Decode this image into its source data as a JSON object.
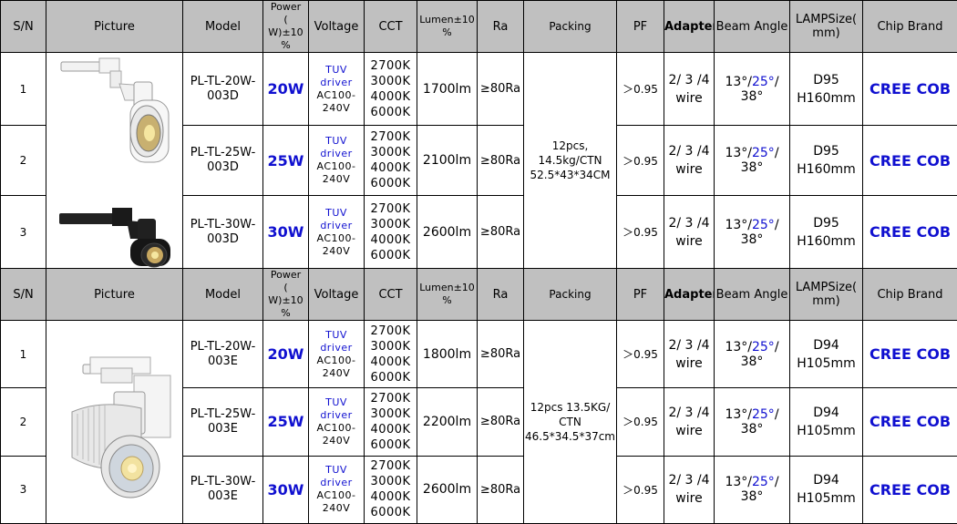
{
  "headers": {
    "sn": "S/N",
    "picture": "Picture",
    "model": "Model",
    "power_l1": "Power",
    "power_l2": "(",
    "power_l3": "W)±10",
    "power_l4": "%",
    "voltage": "Voltage",
    "cct": "CCT",
    "lumen_l1": "Lumen±10",
    "lumen_l2": "%",
    "ra": "Ra",
    "packing": "Packing",
    "pf": "PF",
    "adapter": "Adapter",
    "beam": "Beam Angle",
    "size_l1": "LAMPSize(",
    "size_l2": "mm)",
    "chip": "Chip Brand"
  },
  "groups": [
    {
      "packing": [
        "12pcs,",
        "14.5kg/CTN",
        "52.5*43*34CM"
      ],
      "rows": [
        {
          "sn": "1",
          "model_l1": "PL-TL-20W-",
          "model_l2": "003D",
          "power": "20W",
          "lumen": "1700lm"
        },
        {
          "sn": "2",
          "model_l1": "PL-TL-25W-",
          "model_l2": "003D",
          "power": "25W",
          "lumen": "2100lm"
        },
        {
          "sn": "3",
          "model_l1": "PL-TL-30W-",
          "model_l2": "003D",
          "power": "30W",
          "lumen": "2600lm"
        }
      ],
      "size_l1": "D95",
      "size_l2": "H160mm"
    },
    {
      "packing": [
        "12pcs 13.5KG/",
        "CTN",
        "46.5*34.5*37cm"
      ],
      "rows": [
        {
          "sn": "1",
          "model_l1": "PL-TL-20W-",
          "model_l2": "003E",
          "power": "20W",
          "lumen": "1800lm"
        },
        {
          "sn": "2",
          "model_l1": "PL-TL-25W-",
          "model_l2": "003E",
          "power": "25W",
          "lumen": "2200lm"
        },
        {
          "sn": "3",
          "model_l1": "PL-TL-30W-",
          "model_l2": "003E",
          "power": "30W",
          "lumen": "2600lm"
        }
      ],
      "size_l1": "D94",
      "size_l2": "H105mm"
    }
  ],
  "common": {
    "volt_l1": "TUV",
    "volt_l2": "driver",
    "volt_l3": "AC100-",
    "volt_l4": "240V",
    "cct_l1": "2700K",
    "cct_l2": "3000K",
    "cct_l3": "4000K",
    "cct_l4": "6000K",
    "ra": "≥80Ra",
    "pf": "＞0.95",
    "adapter_l1": "2/ 3 /4",
    "adapter_l2": "wire",
    "beam_a": "13°/",
    "beam_b": "25°",
    "beam_c": "/ 38°",
    "chip": "CREE COB"
  },
  "colors": {
    "header_bg": "#c0c0c0",
    "accent_blue": "#1010d0"
  }
}
